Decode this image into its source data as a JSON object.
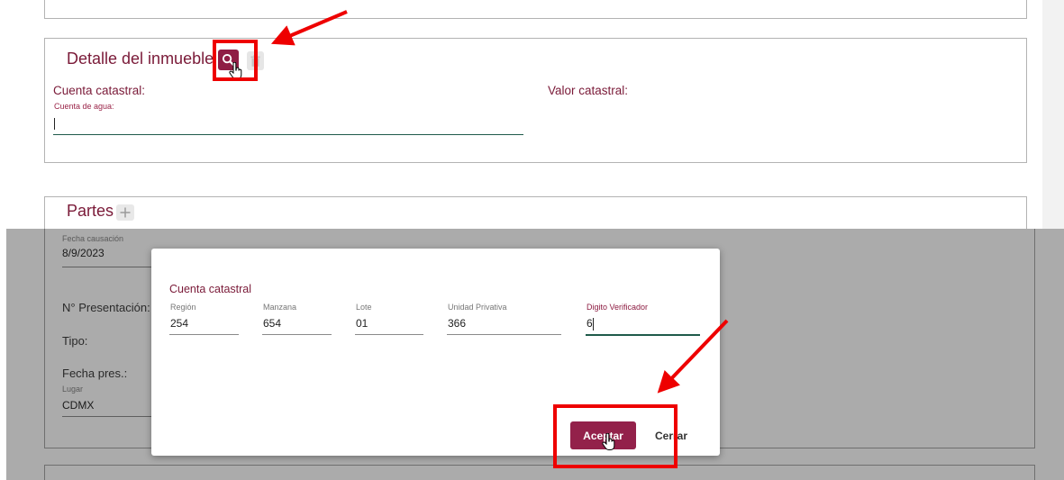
{
  "detalle": {
    "title": "Detalle del inmueble",
    "search_icon": "search-icon",
    "delete_icon": "trash-icon",
    "cuenta_catastral_label": "Cuenta catastral:",
    "valor_catastral_label": "Valor catastral:",
    "cuenta_agua_label": "Cuenta de agua:",
    "cuenta_agua_value": ""
  },
  "partes": {
    "title": "Partes",
    "add_icon": "plus-icon"
  },
  "background_form": {
    "fecha_causacion_label": "Fecha causación",
    "fecha_causacion_value": "8/9/2023",
    "presentacion_label": "N° Presentación:",
    "tipo_label": "Tipo:",
    "fecha_pres_label": "Fecha pres.:",
    "lugar_label": "Lugar",
    "lugar_value": "CDMX"
  },
  "modal": {
    "title": "Cuenta catastral",
    "fields": [
      {
        "label": "Región",
        "value": "254"
      },
      {
        "label": "Manzana",
        "value": "654"
      },
      {
        "label": "Lote",
        "value": "01"
      },
      {
        "label": "Unidad Privativa",
        "value": "366"
      },
      {
        "label": "Digito Verificador",
        "value": "6"
      }
    ],
    "accept_label": "Aceptar",
    "close_label": "Cerrar"
  },
  "colors": {
    "brand": "#93214a",
    "accent_line": "#1f5a4a",
    "annotation": "#ee0000"
  }
}
